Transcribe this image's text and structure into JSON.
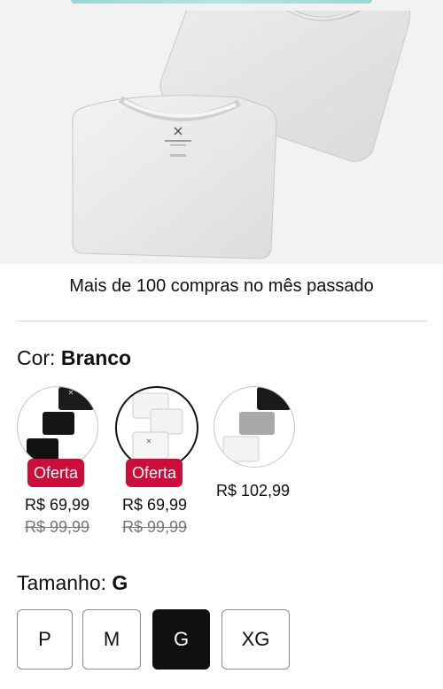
{
  "purchases_note": "Mais de 100 compras no mês passado",
  "color": {
    "label": "Cor:",
    "selected": "Branco",
    "options": [
      {
        "icon": "black-shirts-thumbnail",
        "badge": "Oferta",
        "price": "R$ 69,99",
        "old_price": "R$ 99,99"
      },
      {
        "icon": "white-shirts-thumbnail",
        "badge": "Oferta",
        "price": "R$ 69,99",
        "old_price": "R$ 99,99"
      },
      {
        "icon": "mixed-shirts-thumbnail",
        "price": "R$ 102,99"
      }
    ]
  },
  "size": {
    "label": "Tamanho:",
    "selected": "G",
    "options": [
      "P",
      "M",
      "G",
      "XG"
    ]
  },
  "colors": {
    "offer_badge": "#cc0c39",
    "selected_size_bg": "#0f1111",
    "text": "#0f1111",
    "strike_price": "#767676"
  }
}
